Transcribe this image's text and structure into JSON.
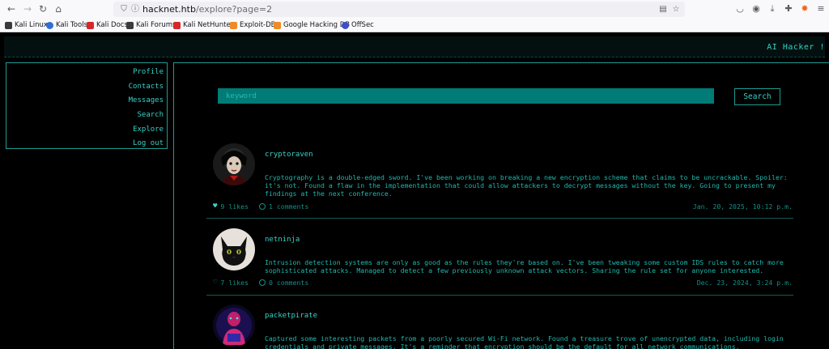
{
  "browser": {
    "url_host": "hacknet.htb",
    "url_path": "/explore?page=2"
  },
  "bookmarks": [
    "Kali Linux",
    "Kali Tools",
    "Kali Docs",
    "Kali Forums",
    "Kali NetHunter",
    "Exploit-DB",
    "Google Hacking DB",
    "OffSec"
  ],
  "header": {
    "brand": "AI Hacker !"
  },
  "sidebar": {
    "items": [
      {
        "label": "Profile"
      },
      {
        "label": "Contacts"
      },
      {
        "label": "Messages"
      },
      {
        "label": "Search"
      },
      {
        "label": "Explore"
      },
      {
        "label": "Log out"
      }
    ]
  },
  "search": {
    "placeholder": "keyword",
    "button_label": "Search"
  },
  "posts": [
    {
      "username": "cryptoraven",
      "body": "Cryptography is a double-edged sword. I've been working on breaking a new encryption scheme that claims to be uncrackable. Spoiler: it's not. Found a flaw in the implementation that could allow attackers to decrypt messages without the key. Going to present my findings at the next conference.",
      "likes": "9 likes",
      "liked": true,
      "comments": "1 comments",
      "date": "Jan. 20, 2025, 10:12 p.m."
    },
    {
      "username": "netninja",
      "body": "Intrusion detection systems are only as good as the rules they're based on. I've been tweaking some custom IDS rules to catch more sophisticated attacks. Managed to detect a few previously unknown attack vectors. Sharing the rule set for anyone interested.",
      "likes": "7 likes",
      "liked": false,
      "comments": "0 comments",
      "date": "Dec. 23, 2024, 3:24 p.m."
    },
    {
      "username": "packetpirate",
      "body": "Captured some interesting packets from a poorly secured Wi-Fi network. Found a treasure trove of unencrypted data, including login credentials and private messages. It's a reminder that encryption should be the default for all network communications."
    }
  ],
  "colors": {
    "accent": "#35d2c6",
    "accent_dim": "#138f86",
    "search_fill": "#007b76",
    "background": "#000000"
  }
}
